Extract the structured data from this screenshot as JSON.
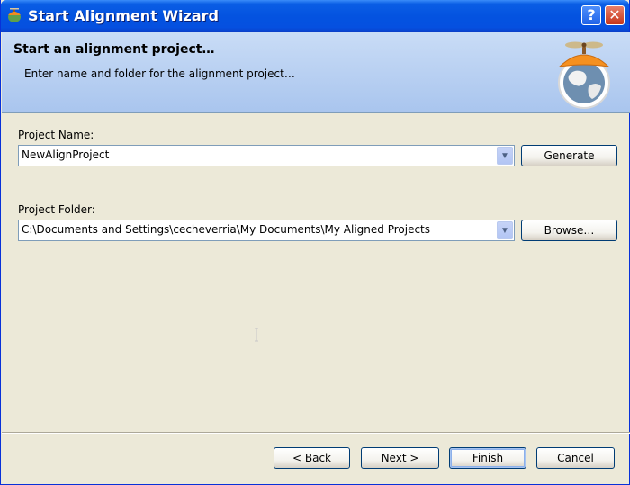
{
  "window": {
    "title": "Start Alignment Wizard",
    "help_label": "?",
    "close_label": "✕"
  },
  "header": {
    "title": "Start an alignment project…",
    "subtitle": "Enter name and folder for the alignment project…"
  },
  "form": {
    "project_name_label": "Project Name:",
    "project_name_value": "NewAlignProject",
    "generate_label": "Generate",
    "project_folder_label": "Project Folder:",
    "project_folder_value": "C:\\Documents and Settings\\cecheverria\\My Documents\\My Aligned Projects",
    "browse_label": "Browse…"
  },
  "footer": {
    "back_label": "< Back",
    "next_label": "Next >",
    "finish_label": "Finish",
    "cancel_label": "Cancel"
  },
  "colors": {
    "titlebar": "#0453e0",
    "header_bg": "#b9d0f2",
    "dialog_bg": "#ece9d8"
  }
}
